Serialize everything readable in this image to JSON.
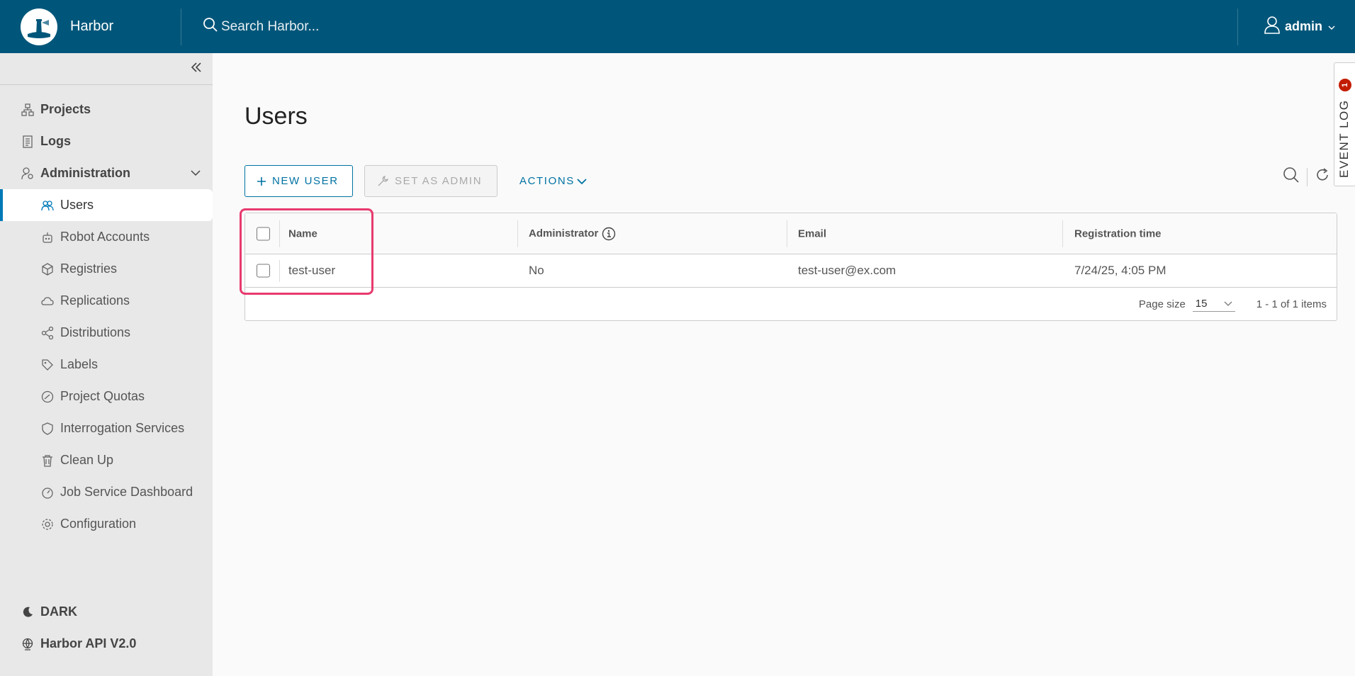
{
  "header": {
    "brand": "Harbor",
    "search_placeholder": "Search Harbor...",
    "user": "admin"
  },
  "sidebar": {
    "items": [
      {
        "label": "Projects"
      },
      {
        "label": "Logs"
      },
      {
        "label": "Administration"
      }
    ],
    "admin_items": [
      {
        "label": "Users"
      },
      {
        "label": "Robot Accounts"
      },
      {
        "label": "Registries"
      },
      {
        "label": "Replications"
      },
      {
        "label": "Distributions"
      },
      {
        "label": "Labels"
      },
      {
        "label": "Project Quotas"
      },
      {
        "label": "Interrogation Services"
      },
      {
        "label": "Clean Up"
      },
      {
        "label": "Job Service Dashboard"
      },
      {
        "label": "Configuration"
      }
    ],
    "bottom": {
      "theme": "DARK",
      "api": "Harbor API V2.0"
    }
  },
  "main": {
    "title": "Users",
    "toolbar": {
      "new_user": "NEW USER",
      "set_admin": "SET AS ADMIN",
      "actions": "ACTIONS"
    },
    "table": {
      "columns": [
        "Name",
        "Administrator",
        "Email",
        "Registration time"
      ],
      "rows": [
        {
          "name": "test-user",
          "admin": "No",
          "email": "test-user@ex.com",
          "registered": "7/24/25, 4:05 PM"
        }
      ],
      "footer": {
        "page_size_label": "Page size",
        "page_size": "15",
        "count": "1 - 1 of 1 items"
      }
    }
  },
  "event_log": {
    "label": "EVENT LOG",
    "badge": "1"
  },
  "colors": {
    "header": "#00567a",
    "accent": "#0072a3",
    "highlight": "#e83a6e",
    "badge": "#c21d00"
  }
}
